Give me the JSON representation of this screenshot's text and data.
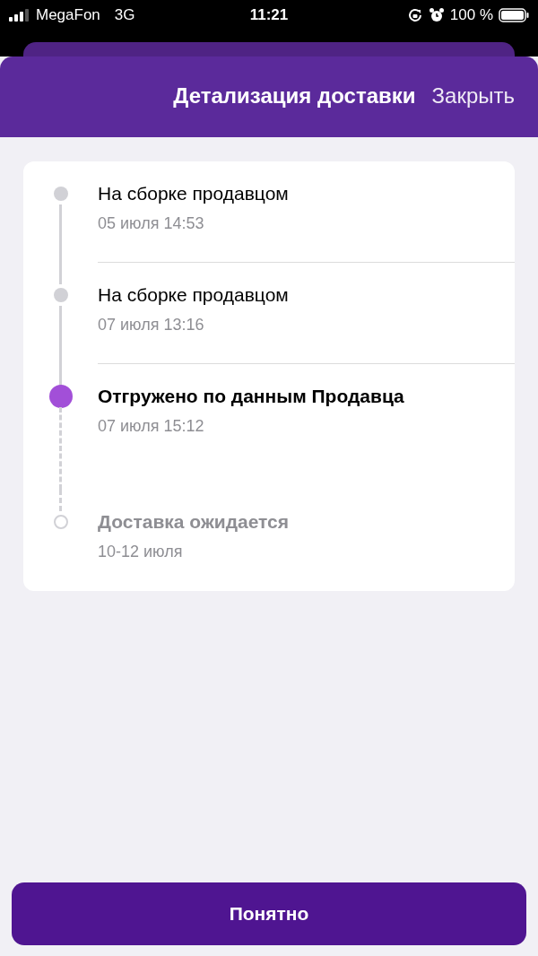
{
  "status_bar": {
    "carrier": "MegaFon",
    "network": "3G",
    "time": "11:21",
    "battery": "100 %"
  },
  "header": {
    "title": "Детализация доставки",
    "close": "Закрыть"
  },
  "timeline": [
    {
      "kind": "done",
      "title": "На сборке продавцом",
      "date": "05 июля 14:53"
    },
    {
      "kind": "done",
      "title": "На сборке продавцом",
      "date": "07 июля 13:16"
    },
    {
      "kind": "current",
      "title": "Отгружено по данным Продавца",
      "date": "07 июля 15:12"
    },
    {
      "kind": "pending",
      "title": "Доставка ожидается",
      "date": "10-12 июля"
    }
  ],
  "button": "Понятно"
}
